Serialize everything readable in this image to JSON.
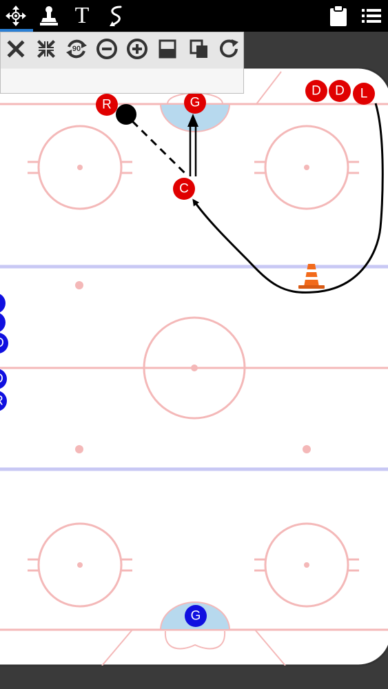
{
  "toolbar": {
    "tools": [
      {
        "name": "move-tool",
        "icon": "move-arrows-icon",
        "active": true
      },
      {
        "name": "player-tool",
        "icon": "stamp-icon",
        "active": false
      },
      {
        "name": "text-tool",
        "icon": "text-icon",
        "glyph": "T",
        "active": false
      },
      {
        "name": "draw-tool",
        "icon": "freehand-line-icon",
        "active": false
      }
    ],
    "right": [
      {
        "name": "clipboard-button",
        "icon": "clipboard-icon"
      },
      {
        "name": "menu-button",
        "icon": "list-menu-icon"
      }
    ],
    "accent": "#2a7fd4"
  },
  "edit_tools": {
    "rotate_label": "90",
    "items": [
      "delete-icon",
      "shrink-icon",
      "rotate-90-icon",
      "zoom-out-icon",
      "zoom-in-icon",
      "half-rink-icon",
      "copy-icon",
      "redo-icon"
    ]
  },
  "rink": {
    "line_color": "#f4b8b8",
    "blue_line_color": "#c8c8f4",
    "crease_color": "#b7d9ee"
  },
  "players_red": {
    "color": "#e00000",
    "items": [
      {
        "label": "R"
      },
      {
        "label": "G"
      },
      {
        "label": "C"
      },
      {
        "label": "D"
      },
      {
        "label": "D"
      },
      {
        "label": "L"
      }
    ]
  },
  "players_blue": {
    "color": "#1010e0",
    "goalie": {
      "label": "G"
    },
    "bench": [
      {
        "label": ""
      },
      {
        "label": ""
      },
      {
        "label": "D"
      },
      {
        "label": "D"
      },
      {
        "label": "R"
      }
    ]
  },
  "puck": {
    "color": "#000000"
  },
  "cone": {
    "icon": "traffic-cone-icon",
    "color": "#f26a1b"
  }
}
